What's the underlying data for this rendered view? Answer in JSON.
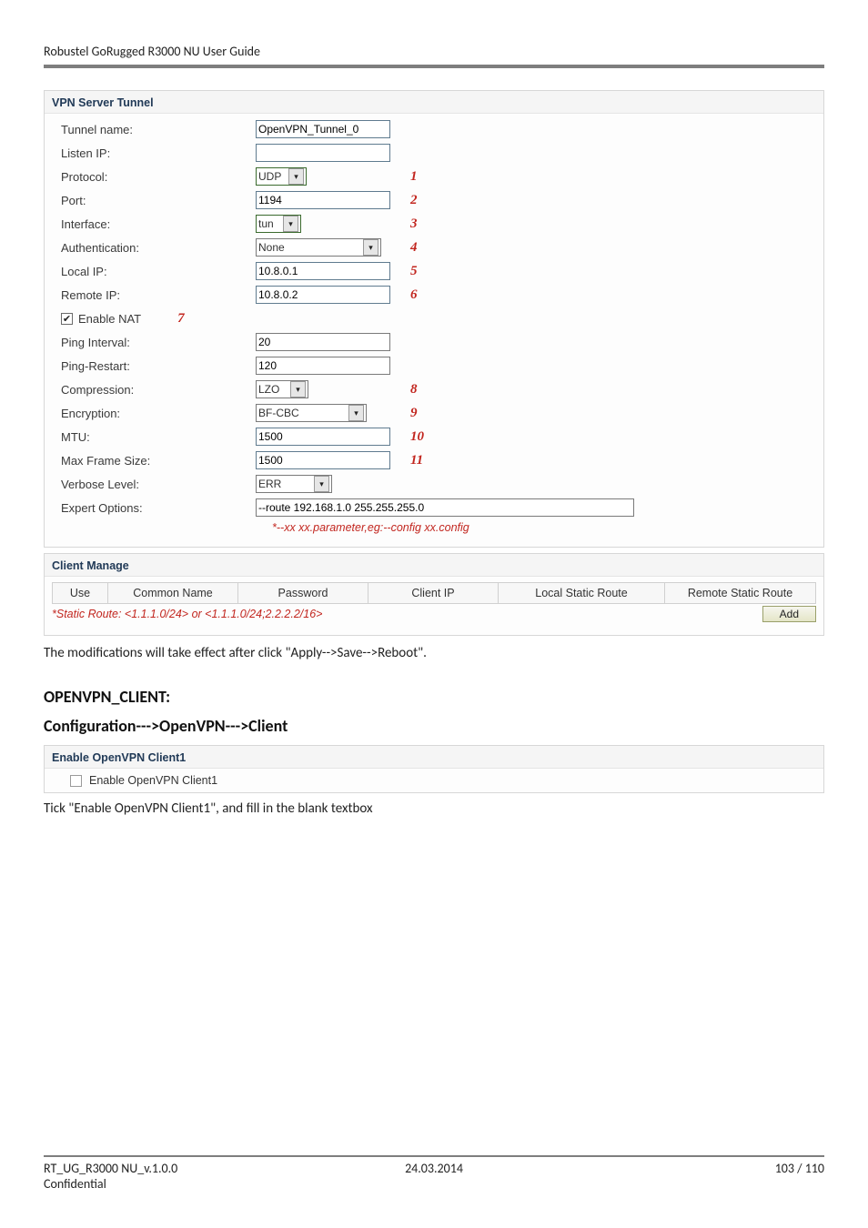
{
  "header": {
    "title": "Robustel GoRugged R3000 NU User Guide"
  },
  "vpn_panel": {
    "title": "VPN Server Tunnel",
    "rows": {
      "tunnel_name": {
        "label": "Tunnel name:",
        "value": "OpenVPN_Tunnel_0"
      },
      "listen_ip": {
        "label": "Listen IP:",
        "value": ""
      },
      "protocol": {
        "label": "Protocol:",
        "value": "UDP",
        "annot": "1"
      },
      "port": {
        "label": "Port:",
        "value": "1194",
        "annot": "2"
      },
      "interface": {
        "label": "Interface:",
        "value": "tun",
        "annot": "3"
      },
      "auth": {
        "label": "Authentication:",
        "value": "None",
        "annot": "4"
      },
      "local_ip": {
        "label": "Local IP:",
        "value": "10.8.0.1",
        "annot": "5"
      },
      "remote_ip": {
        "label": "Remote IP:",
        "value": "10.8.0.2",
        "annot": "6"
      },
      "enable_nat": {
        "label": "Enable NAT",
        "checked": true,
        "annot": "7"
      },
      "ping_int": {
        "label": "Ping Interval:",
        "value": "20"
      },
      "ping_restart": {
        "label": "Ping-Restart:",
        "value": "120"
      },
      "compression": {
        "label": "Compression:",
        "value": "LZO",
        "annot": "8"
      },
      "encryption": {
        "label": "Encryption:",
        "value": "BF-CBC",
        "annot": "9"
      },
      "mtu": {
        "label": "MTU:",
        "value": "1500",
        "annot": "10"
      },
      "max_frame": {
        "label": "Max Frame Size:",
        "value": "1500",
        "annot": "11"
      },
      "verbose": {
        "label": "Verbose Level:",
        "value": "ERR"
      },
      "expert": {
        "label": "Expert Options:",
        "value": "--route 192.168.1.0 255.255.255.0"
      }
    },
    "hint": "*--xx xx.parameter,eg:--config xx.config"
  },
  "client_manage": {
    "title": "Client Manage",
    "headers": {
      "use": "Use",
      "common_name": "Common Name",
      "password": "Password",
      "client_ip": "Client IP",
      "local_route": "Local Static Route",
      "remote_route": "Remote Static Route"
    },
    "hint": "*Static Route: <1.1.1.0/24> or <1.1.1.0/24;2.2.2.2/16>",
    "add_label": "Add"
  },
  "body": {
    "after_apply": "The modifications will take effect after click \"Apply-->Save-->Reboot\".",
    "section_client": "OPENVPN_CLIENT:",
    "config_path": "Configuration--->OpenVPN--->Client"
  },
  "enable_client": {
    "title": "Enable OpenVPN Client1",
    "label": "Enable OpenVPN Client1"
  },
  "body2": {
    "tick_text": "Tick \"Enable OpenVPN Client1\", and fill in the blank textbox"
  },
  "footer": {
    "left": "RT_UG_R3000 NU_v.1.0.0",
    "center": "24.03.2014",
    "right": "103 / 110",
    "confidential": "Confidential"
  }
}
